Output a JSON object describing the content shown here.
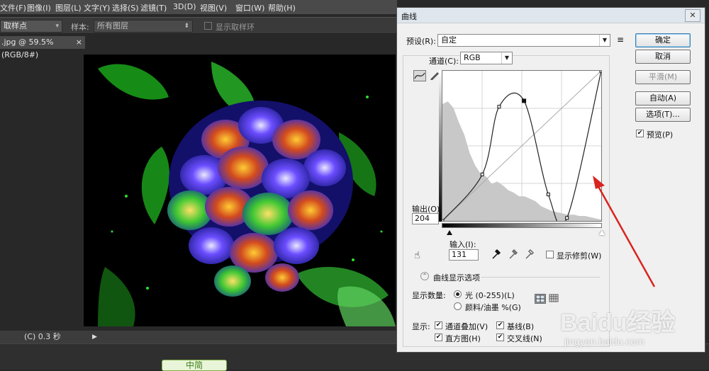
{
  "menubar": {
    "items": [
      "文件(F)",
      "图像(I)",
      "图层(L)",
      "文字(Y)",
      "选择(S)",
      "滤镜(T)",
      "3D(D)",
      "视图(V)",
      "窗口(W)",
      "帮助(H)"
    ]
  },
  "options_bar": {
    "sample_tool": "取样点",
    "sample_label": "样本:",
    "sample_value": "所有图层",
    "show_ring_label": "显示取样环"
  },
  "document": {
    "tab_title": ".jpg @ 59.5%(RGB/8#)",
    "tab_close": "×",
    "status_text": "(C) 0.3 秒",
    "status_arrow": "▶"
  },
  "dialog": {
    "title": "曲线",
    "close": "✕",
    "preset_label": "预设(R):",
    "preset_value": "自定",
    "channel_label": "通道(C):",
    "channel_value": "RGB",
    "output_label": "输出(O):",
    "output_value": "204",
    "input_label": "输入(I):",
    "input_value": "131",
    "show_clipping_label": "显示修剪(W)",
    "curve_display_options": "曲线显示选项",
    "display_amount_label": "显示数量:",
    "light_option": "光 (0-255)(L)",
    "pigment_option": "颜料/油墨 %(G)",
    "show_label": "显示:",
    "channel_overlay": "通道叠加(V)",
    "baseline": "基线(B)",
    "histogram": "直方图(H)",
    "intersection": "交叉线(N)",
    "buttons": {
      "ok": "确定",
      "cancel": "取消",
      "smooth": "平滑(M)",
      "auto": "自动(A)",
      "options": "选项(T)..."
    },
    "preview_label": "预览(P)",
    "checkmark": "✔",
    "curve_points": [
      [
        0,
        0
      ],
      [
        64,
        79
      ],
      [
        91,
        194
      ],
      [
        131,
        204
      ],
      [
        170,
        45
      ],
      [
        200,
        5
      ],
      [
        255,
        255
      ]
    ]
  },
  "watermark": {
    "brand": "Baidu经验",
    "url": "jingyan.baidu.com"
  },
  "bottom_tag": "中简"
}
